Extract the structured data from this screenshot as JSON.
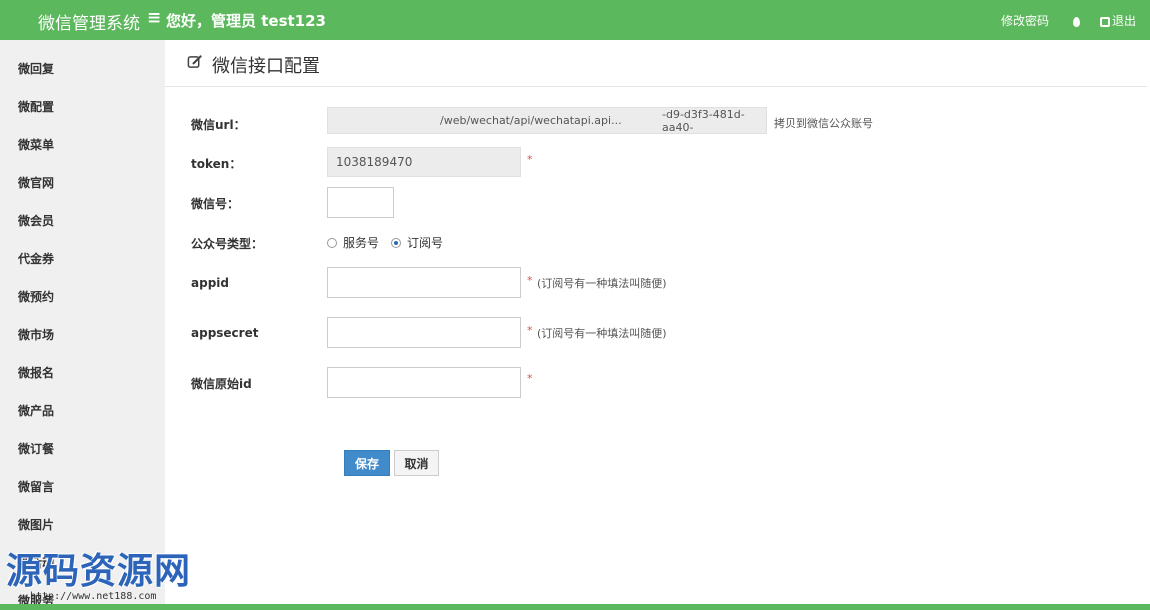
{
  "header": {
    "brand": "微信管理系统",
    "menu_glyph": "≡",
    "greeting": "您好，管理员 test123",
    "change_password": "修改密码",
    "logout": "退出"
  },
  "sidebar": {
    "items": [
      {
        "label": "微回复"
      },
      {
        "label": "微配置"
      },
      {
        "label": "微菜单"
      },
      {
        "label": "微官网"
      },
      {
        "label": "微会员"
      },
      {
        "label": "代金券"
      },
      {
        "label": "微预约"
      },
      {
        "label": "微市场"
      },
      {
        "label": "微报名"
      },
      {
        "label": "微产品"
      },
      {
        "label": "微订餐"
      },
      {
        "label": "微留言"
      },
      {
        "label": "微图片"
      },
      {
        "label": "微活动"
      },
      {
        "label": "微服务"
      }
    ]
  },
  "page": {
    "title": "微信接口配置"
  },
  "form": {
    "url": {
      "label": "微信url：",
      "value_a": "/web/wechat/api/wechatapi.api...",
      "value_b": "-d9-d3f3-481d-aa40-",
      "hint": "拷贝到微信公众账号"
    },
    "token": {
      "label": "token：",
      "value": "1038189470",
      "required": "*"
    },
    "wechat_id": {
      "label": "微信号：",
      "value": ""
    },
    "account_type": {
      "label": "公众号类型：",
      "options": [
        {
          "label": "服务号",
          "checked": false
        },
        {
          "label": "订阅号",
          "checked": true
        }
      ]
    },
    "appid": {
      "label": "appid",
      "value": "",
      "required": "*",
      "hint": "(订阅号有一种填法叫随便)"
    },
    "appsecret": {
      "label": "appsecret",
      "value": "",
      "required": "*",
      "hint": "(订阅号有一种填法叫随便)"
    },
    "original_id": {
      "label": "微信原始id",
      "value": "",
      "required": "*"
    },
    "save_label": "保存",
    "cancel_label": "取消"
  },
  "watermark": {
    "title": "源码资源网",
    "url": "http://www.net188.com"
  },
  "colors": {
    "header_green": "#5cb85c",
    "sidebar_bg": "#f0f0f0",
    "primary_blue": "#428bca",
    "required_red": "#d9534f"
  }
}
